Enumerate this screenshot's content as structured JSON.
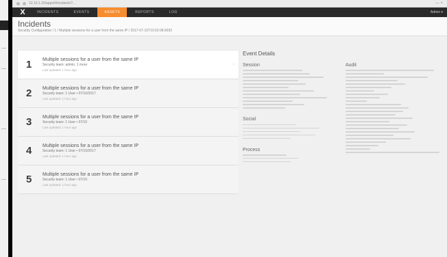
{
  "browser": {
    "url": "10.10.1.20/apps/#/incidents?...",
    "window_controls": "— ×"
  },
  "nav": {
    "logo": "X",
    "items": [
      "Incidents",
      "Events",
      "Assets",
      "Reports",
      "Log"
    ],
    "active_index": 2,
    "user": "Admin ▾"
  },
  "header": {
    "title": "Incidents",
    "breadcrumb": "Security Configuration  /  1  /  Multiple sessions for a user from the same IP  /  2017-07-10T10:02:08.6692"
  },
  "incidents": [
    {
      "num": "1",
      "title": "Multiple sessions for a user from the same IP",
      "sub": "Security team: admin, 1 more",
      "meta": "Last updated: 1 hour ago"
    },
    {
      "num": "2",
      "title": "Multiple sessions for a user from the same IP",
      "sub": "Security team: 1 User • 07/10/2017",
      "meta": "Last updated: 1 hour ago"
    },
    {
      "num": "3",
      "title": "Multiple sessions for a user from the same IP",
      "sub": "Security team: 1 User • 07/10",
      "meta": "Last updated: 1 hour ago"
    },
    {
      "num": "4",
      "title": "Multiple sessions for a user from the same IP",
      "sub": "Security team: 1 User • 07/10/2017",
      "meta": "Last updated: 1 hour ago"
    },
    {
      "num": "5",
      "title": "Multiple sessions for a user from the same IP",
      "sub": "Security team: 1 User • 07/10",
      "meta": "Last updated: 1 hour ago"
    }
  ],
  "details": {
    "title": "Event Details",
    "sections": {
      "session": "Session",
      "audit": "Audit",
      "social": "Social",
      "process": "Process"
    }
  }
}
